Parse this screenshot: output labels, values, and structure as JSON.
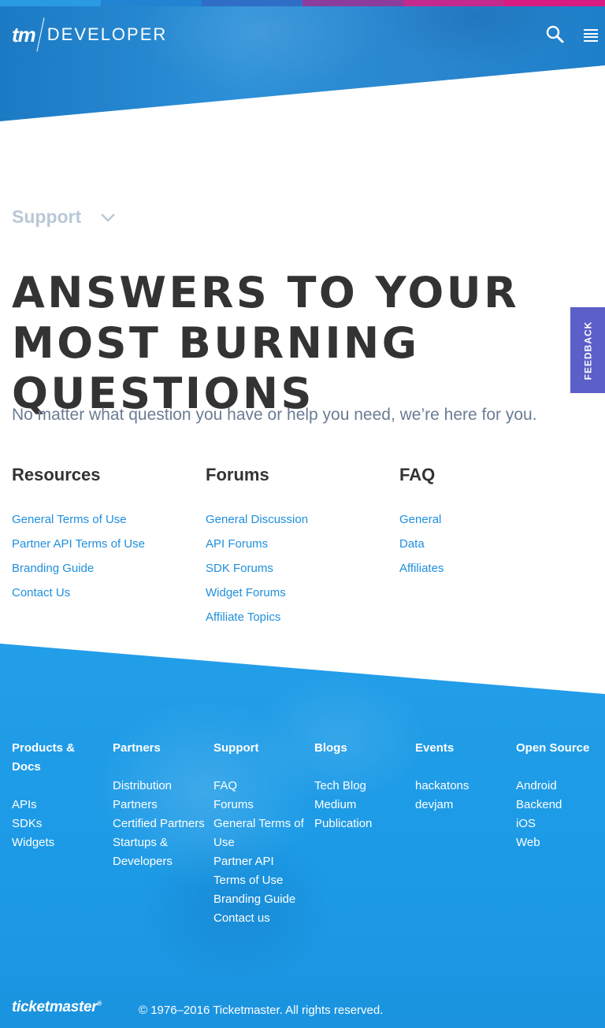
{
  "colors": {
    "strip": [
      "#2a9be3",
      "#2283d2",
      "#2f6ec6",
      "#8c3c9c",
      "#c42a8e",
      "#d81b80"
    ],
    "header_blue": "#2a8fd6",
    "link_blue": "#1f8fdd",
    "feedback_purple": "#5b5fc7",
    "footer_blue": "#1d9ae6"
  },
  "header": {
    "logo_tm": "tm",
    "logo_developer": "DEVELOPER",
    "search_icon": "search-icon",
    "menu_icon": "hamburger-menu-icon"
  },
  "support": {
    "dropdown_label": "Support",
    "headline": "Answers to your most burning questions",
    "subline": "No matter what question you have or help you need, we’re here for you."
  },
  "columns": [
    {
      "title": "Resources",
      "links": [
        "General Terms of Use",
        "Partner API Terms of Use",
        "Branding Guide",
        "Contact Us"
      ]
    },
    {
      "title": "Forums",
      "links": [
        "General Discussion",
        "API Forums",
        "SDK Forums",
        "Widget Forums",
        "Affiliate Topics"
      ]
    },
    {
      "title": "FAQ",
      "links": [
        "General",
        "Data",
        "Affiliates"
      ]
    }
  ],
  "feedback_label": "FEEDBACK",
  "footer": {
    "columns": [
      {
        "title": "Products & Docs",
        "links": [
          "APIs",
          "SDKs",
          "Widgets"
        ]
      },
      {
        "title": "Partners",
        "links": [
          "Distribution Partners",
          "Certified Partners",
          "Startups & Developers"
        ]
      },
      {
        "title": "Support",
        "links": [
          "FAQ",
          "Forums",
          "General Terms of Use",
          "Partner API Terms of Use",
          "Branding Guide",
          "Contact us"
        ]
      },
      {
        "title": "Blogs",
        "links": [
          "Tech Blog",
          "Medium Publication"
        ]
      },
      {
        "title": "Events",
        "links": [
          "hackatons",
          "devjam"
        ]
      },
      {
        "title": "Open Source",
        "links": [
          "Android",
          "Backend",
          "iOS",
          "Web"
        ]
      }
    ],
    "brand": "ticketmaster",
    "copyright": "© 1976–2016 Ticketmaster. All rights reserved."
  }
}
